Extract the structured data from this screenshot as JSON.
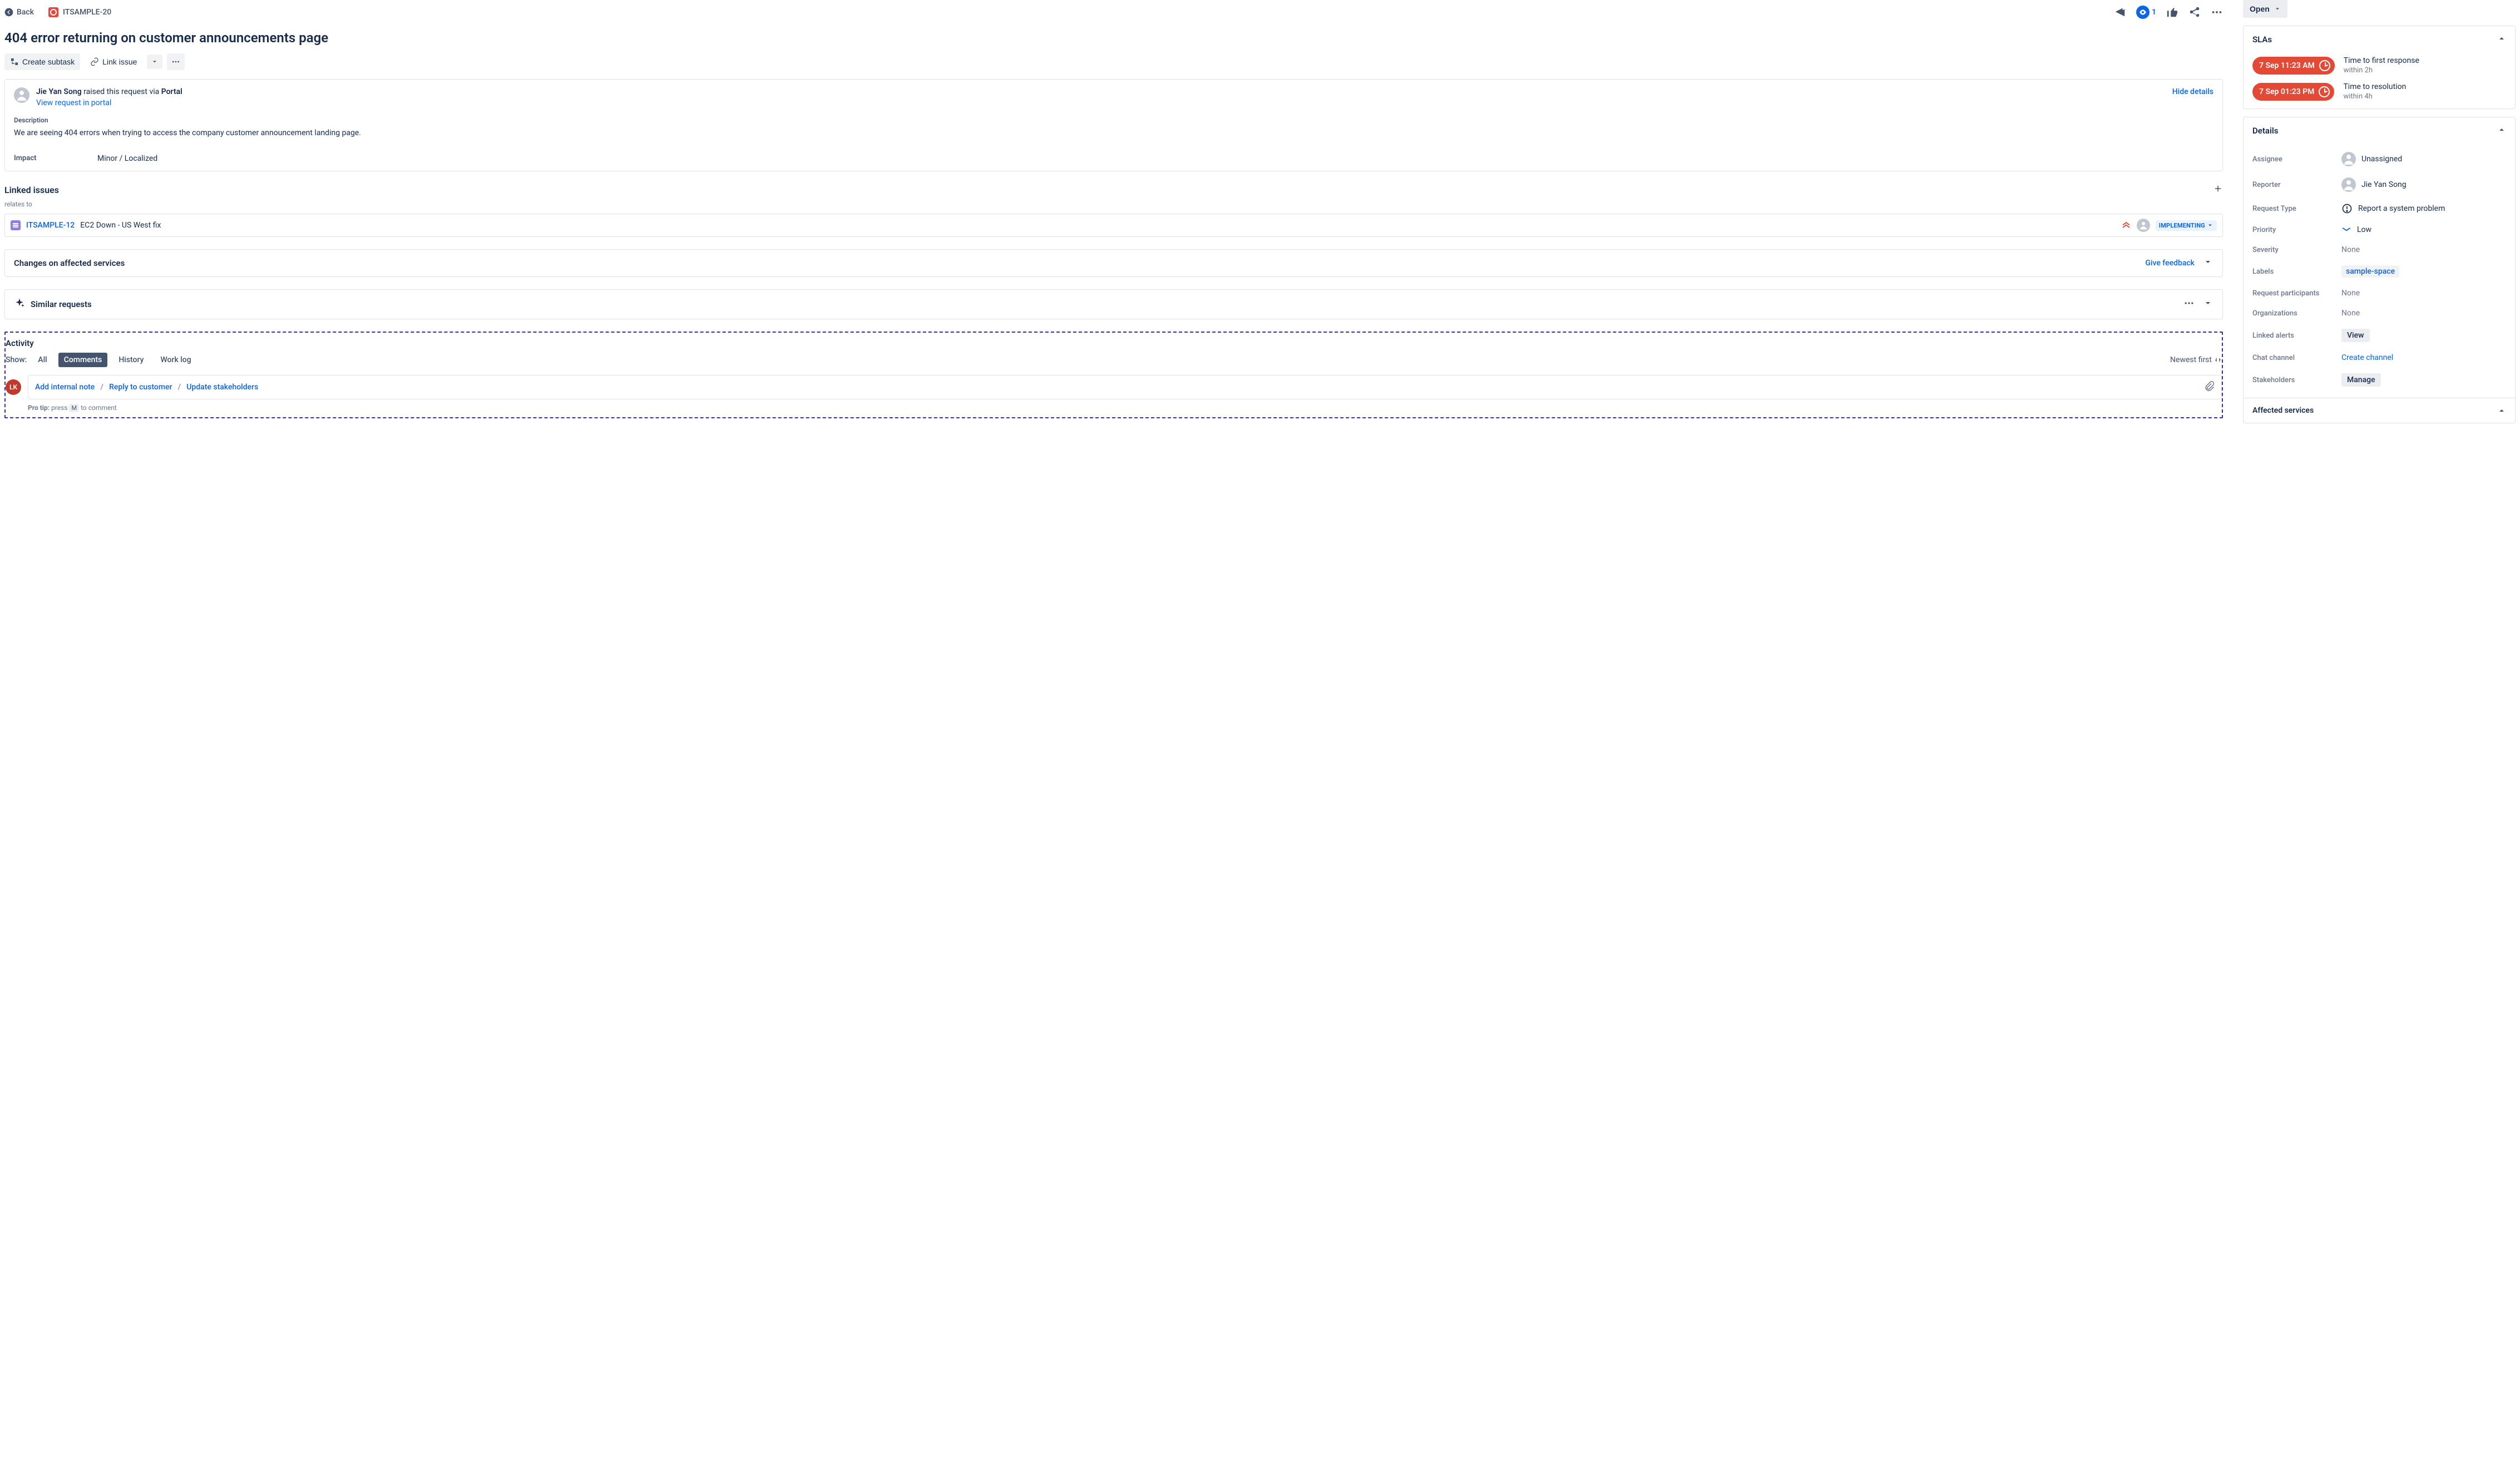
{
  "back_label": "Back",
  "issue_key": "ITSAMPLE-20",
  "title": "404 error returning on customer announcements page",
  "toolbar": {
    "create_subtask": "Create subtask",
    "link_issue": "Link issue"
  },
  "watch_count": "1",
  "requester": {
    "name": "Jie Yan Song",
    "via_text": " raised this request via ",
    "via_source": "Portal",
    "view_portal": "View request in portal",
    "hide_details": "Hide details"
  },
  "description": {
    "label": "Description",
    "text": "We are seeing 404 errors when trying to access the company customer announcement landing page."
  },
  "impact": {
    "label": "Impact",
    "value": "Minor / Localized"
  },
  "linked_issues": {
    "heading": "Linked issues",
    "relation": "relates to",
    "item": {
      "key": "ITSAMPLE-12",
      "summary": "EC2 Down - US West fix",
      "status": "IMPLEMENTING"
    }
  },
  "affected_services": {
    "heading": "Changes on affected services",
    "feedback": "Give feedback"
  },
  "similar_requests": {
    "heading": "Similar requests"
  },
  "activity": {
    "heading": "Activity",
    "show_label": "Show:",
    "tabs": {
      "all": "All",
      "comments": "Comments",
      "history": "History",
      "worklog": "Work log"
    },
    "sort": "Newest first",
    "compose": {
      "internal": "Add internal note",
      "reply": "Reply to customer",
      "update": "Update stakeholders"
    },
    "avatar_initials": "LK",
    "pro_tip_prefix": "Pro tip:",
    "pro_tip_press": " press ",
    "pro_tip_key": "M",
    "pro_tip_suffix": " to comment"
  },
  "status": "Open",
  "slas": {
    "heading": "SLAs",
    "items": [
      {
        "time": "7 Sep 11:23 AM",
        "name": "Time to first response",
        "within": "within 2h"
      },
      {
        "time": "7 Sep 01:23 PM",
        "name": "Time to resolution",
        "within": "within 4h"
      }
    ]
  },
  "details": {
    "heading": "Details",
    "assignee": {
      "label": "Assignee",
      "value": "Unassigned"
    },
    "reporter": {
      "label": "Reporter",
      "value": "Jie Yan Song"
    },
    "request_type": {
      "label": "Request Type",
      "value": "Report a system problem"
    },
    "priority": {
      "label": "Priority",
      "value": "Low"
    },
    "severity": {
      "label": "Severity",
      "value": "None"
    },
    "labels": {
      "label": "Labels",
      "value": "sample-space"
    },
    "participants": {
      "label": "Request participants",
      "value": "None"
    },
    "organizations": {
      "label": "Organizations",
      "value": "None"
    },
    "linked_alerts": {
      "label": "Linked alerts",
      "value": "View"
    },
    "chat_channel": {
      "label": "Chat channel",
      "value": "Create channel"
    },
    "stakeholders": {
      "label": "Stakeholders",
      "value": "Manage"
    },
    "affected_services": "Affected services"
  }
}
